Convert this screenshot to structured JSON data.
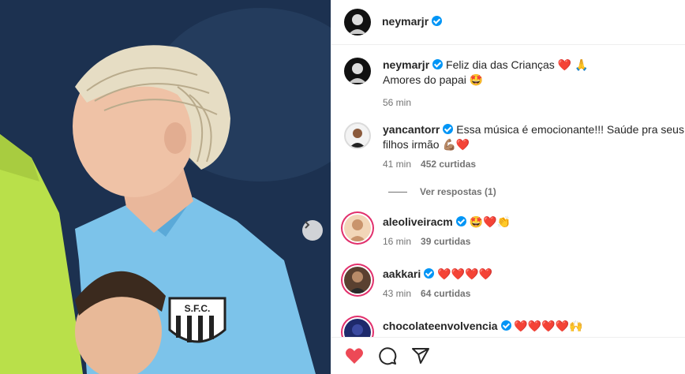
{
  "post": {
    "author": "neymarjr",
    "caption": {
      "username": "neymarjr",
      "line1": "Feliz dia das Crianças ❤️ 🙏",
      "line2": "Amores do papai 🤩",
      "time": "56 min"
    }
  },
  "comments": [
    {
      "username": "yancantorr",
      "text": "Essa música é emocionante!!! Saúde pra seus",
      "text2": "filhos irmão 💪🏽❤️",
      "time": "41 min",
      "likes": "452 curtidas"
    },
    {
      "username": "aleoliveiracm",
      "text": "🤩❤️👏",
      "time": "16 min",
      "likes": "39 curtidas"
    },
    {
      "username": "aakkari",
      "text": "❤️❤️❤️❤️",
      "time": "43 min",
      "likes": "64 curtidas"
    },
    {
      "username": "chocolateenvolvencia",
      "text": "❤️❤️❤️❤️🙌"
    }
  ],
  "view_replies": "Ver respostas (1)",
  "icons": {
    "like": "heart-icon",
    "comment": "comment-icon",
    "share": "share-icon",
    "next": "chevron-right-icon"
  },
  "colors": {
    "verified": "#0095f6",
    "liked": "#ed4956"
  }
}
